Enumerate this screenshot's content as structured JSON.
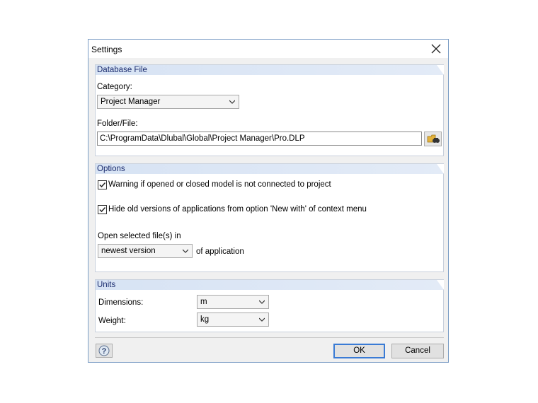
{
  "dialog": {
    "title": "Settings",
    "close_icon": "close-icon"
  },
  "database_file": {
    "heading": "Database File",
    "category_label": "Category:",
    "category_value": "Project Manager",
    "folder_label": "Folder/File:",
    "folder_value": "C:\\ProgramData\\Dlubal\\Global\\Project Manager\\Pro.DLP",
    "browse_icon": "browse-folder-icon"
  },
  "options": {
    "heading": "Options",
    "warning_label": "Warning if opened or closed model is not connected to project",
    "warning_checked": true,
    "hide_old_label": "Hide old versions of applications from option 'New with' of context menu",
    "hide_old_checked": true,
    "open_in_label": "Open selected file(s) in",
    "open_in_value": "newest version",
    "of_application_label": "of application",
    "highlight_color": "#f7f464"
  },
  "units": {
    "heading": "Units",
    "dimensions_label": "Dimensions:",
    "dimensions_value": "m",
    "weight_label": "Weight:",
    "weight_value": "kg"
  },
  "footer": {
    "help_icon": "help-icon",
    "ok_label": "OK",
    "cancel_label": "Cancel"
  }
}
